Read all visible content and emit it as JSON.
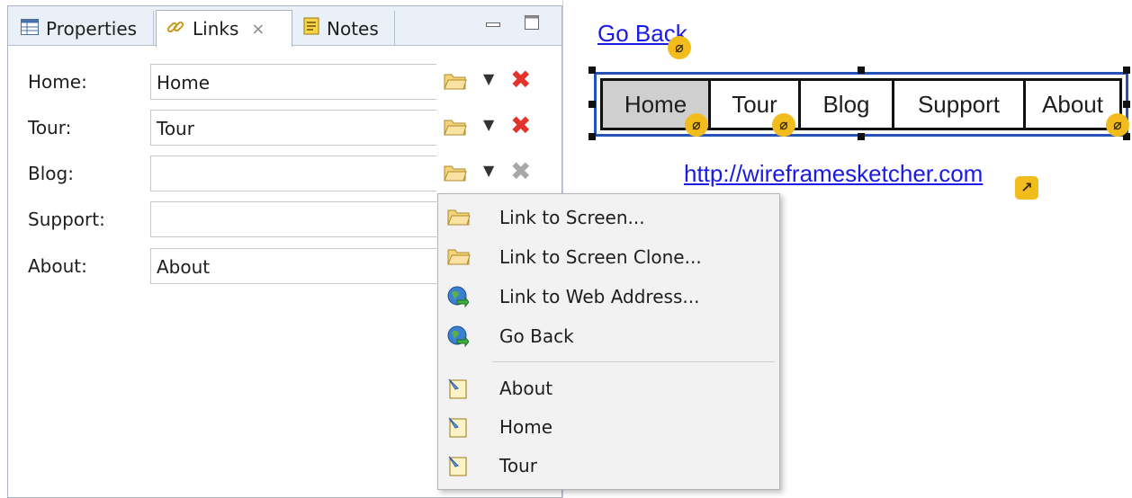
{
  "tabs": [
    {
      "label": "Properties",
      "icon": "table-icon"
    },
    {
      "label": "Links",
      "icon": "link-icon",
      "close": "×",
      "active": true
    },
    {
      "label": "Notes",
      "icon": "note-icon"
    }
  ],
  "window_controls": {
    "minimize": "▭",
    "maximize": "◻"
  },
  "link_rows": [
    {
      "label": "Home:",
      "value": "Home",
      "delete_enabled": true
    },
    {
      "label": "Tour:",
      "value": "Tour",
      "delete_enabled": true
    },
    {
      "label": "Blog:",
      "value": "",
      "delete_enabled": false
    },
    {
      "label": "Support:",
      "value": "",
      "delete_enabled": false
    },
    {
      "label": "About:",
      "value": "About",
      "delete_enabled": false
    }
  ],
  "canvas": {
    "go_back_link": "Go Back",
    "nav_items": [
      {
        "label": "Home",
        "selected": true,
        "linked": true
      },
      {
        "label": "Tour",
        "selected": false,
        "linked": true
      },
      {
        "label": "Blog",
        "selected": false,
        "linked": false
      },
      {
        "label": "Support",
        "selected": false,
        "linked": false
      },
      {
        "label": "About",
        "selected": false,
        "linked": true
      }
    ],
    "url_link": "http://wireframesketcher.com",
    "selection_color": "#2553b8",
    "badge_color": "#f2bd1c"
  },
  "context_menu": {
    "items": [
      {
        "label": "Link to Screen...",
        "icon": "folder-icon"
      },
      {
        "label": "Link to Screen Clone...",
        "icon": "folder-icon"
      },
      {
        "label": "Link to Web Address...",
        "icon": "globe-icon"
      },
      {
        "label": "Go Back",
        "icon": "globe-icon"
      },
      {
        "label": "About",
        "icon": "screen-icon"
      },
      {
        "label": "Home",
        "icon": "screen-icon"
      },
      {
        "label": "Tour",
        "icon": "screen-icon"
      }
    ]
  }
}
